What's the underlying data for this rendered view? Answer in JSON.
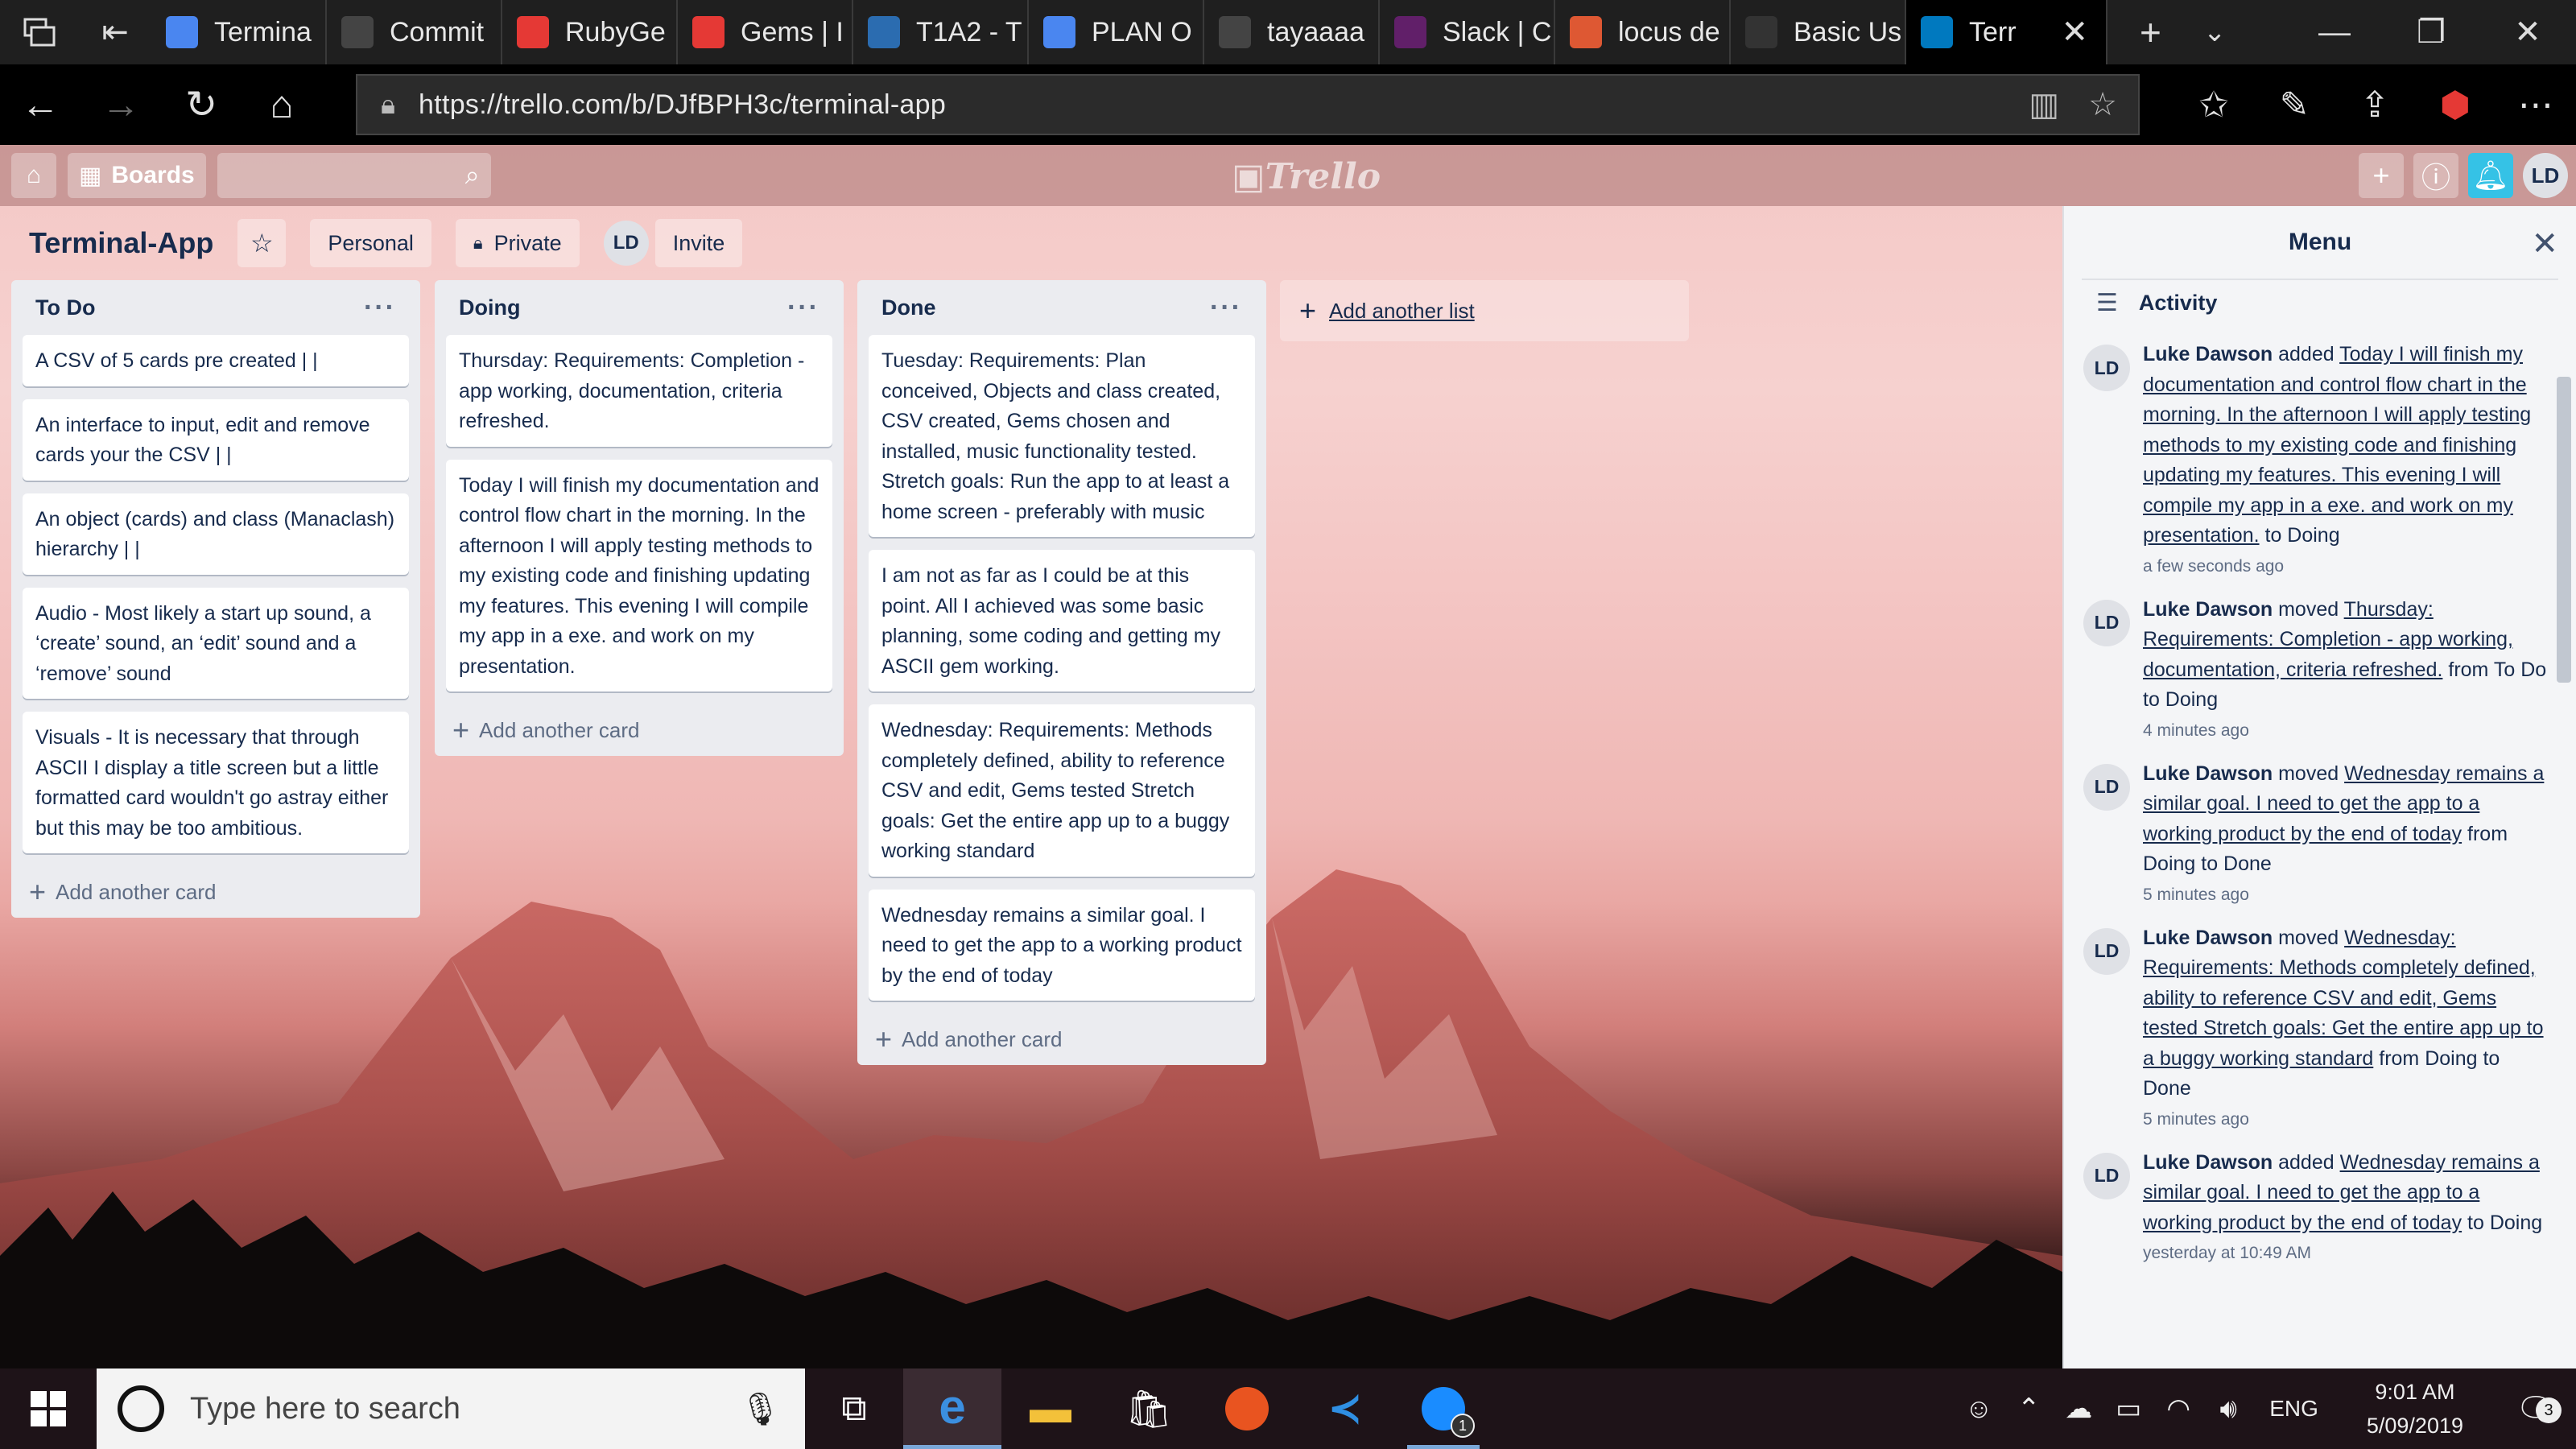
{
  "browser": {
    "tabs": [
      {
        "title": "Termina",
        "icon": "docs-icon",
        "color": "#4a86f0"
      },
      {
        "title": "Commit",
        "icon": "github-icon",
        "color": "#444444"
      },
      {
        "title": "RubyGe",
        "icon": "rubygems-icon",
        "color": "#e53935"
      },
      {
        "title": "Gems | I",
        "icon": "rubygems-icon",
        "color": "#e53935"
      },
      {
        "title": "T1A2 - T",
        "icon": "canvas-icon",
        "color": "#2b6cb0"
      },
      {
        "title": "PLAN O",
        "icon": "docs-icon",
        "color": "#4a86f0"
      },
      {
        "title": "tayaaaa",
        "icon": "github-icon",
        "color": "#444444"
      },
      {
        "title": "Slack | C",
        "icon": "slack-icon",
        "color": "#611f69"
      },
      {
        "title": "locus de",
        "icon": "duckduckgo-icon",
        "color": "#de5833"
      },
      {
        "title": "Basic Us",
        "icon": "user-icon",
        "color": "#333333"
      },
      {
        "title": "Terr",
        "icon": "trello-icon",
        "color": "#0079bf"
      }
    ],
    "url": "https://trello.com/b/DJfBPH3c/terminal-app"
  },
  "trello_header": {
    "boards_label": "Boards",
    "logo": "Trello",
    "avatar": "LD"
  },
  "board": {
    "title": "Terminal-App",
    "visibility_team": "Personal",
    "visibility_privacy": "Private",
    "member_avatar": "LD",
    "invite_label": "Invite"
  },
  "lists": [
    {
      "title": "To Do",
      "cards": [
        "A CSV of 5 cards pre created | |",
        "An interface to input, edit and remove cards your the CSV | |",
        "An object (cards) and class (Manaclash) hierarchy | |",
        "Audio - Most likely a start up sound, a ‘create’ sound, an ‘edit’ sound and a ‘remove’ sound",
        "Visuals - It is necessary that through ASCII I display a title screen but a little formatted card wouldn't go astray either but this may be too ambitious."
      ],
      "add_label": "Add another card"
    },
    {
      "title": "Doing",
      "cards": [
        "Thursday: Requirements: Completion - app working, documentation, criteria refreshed.",
        "Today I will finish my documentation and control flow chart in the morning. In the afternoon I will apply testing methods to my existing code and finishing updating my features. This evening I will compile my app in a exe. and work on my presentation."
      ],
      "add_label": "Add another card"
    },
    {
      "title": "Done",
      "cards": [
        "Tuesday: Requirements: Plan conceived, Objects and class created, CSV created, Gems chosen and installed, music functionality tested. Stretch goals: Run the app to at least a home screen - preferably with music",
        "I am not as far as I could be at this point. All I achieved was some basic planning, some coding and getting my ASCII gem working.",
        "Wednesday: Requirements: Methods completely defined, ability to reference CSV and edit, Gems tested Stretch goals: Get the entire app up to a buggy working standard",
        "Wednesday remains a similar goal. I need to get the app to a working product by the end of today"
      ],
      "add_label": "Add another card"
    }
  ],
  "add_list_label": "Add another list",
  "menu": {
    "title": "Menu",
    "activity_label": "Activity",
    "items": [
      {
        "avatar": "LD",
        "who": "Luke Dawson",
        "verb": " added ",
        "card": "Today I will finish my documentation and control flow chart in the morning. In the afternoon I will apply testing methods to my existing code and finishing updating my features. This evening I will compile my app in a exe. and work on my presentation.",
        "rest": " to Doing",
        "when": "a few seconds ago"
      },
      {
        "avatar": "LD",
        "who": "Luke Dawson",
        "verb": " moved ",
        "card": "Thursday: Requirements: Completion - app working, documentation, criteria refreshed.",
        "rest": " from To Do to Doing",
        "when": "4 minutes ago"
      },
      {
        "avatar": "LD",
        "who": "Luke Dawson",
        "verb": " moved ",
        "card": "Wednesday remains a similar goal. I need to get the app to a working product by the end of today",
        "rest": " from Doing to Done",
        "when": "5 minutes ago"
      },
      {
        "avatar": "LD",
        "who": "Luke Dawson",
        "verb": " moved ",
        "card": "Wednesday: Requirements: Methods completely defined, ability to reference CSV and edit, Gems tested Stretch goals: Get the entire app up to a buggy working standard",
        "rest": " from Doing to Done",
        "when": "5 minutes ago"
      },
      {
        "avatar": "LD",
        "who": "Luke Dawson",
        "verb": " added ",
        "card": "Wednesday remains a similar goal. I need to get the app to a working product by the end of today",
        "rest": " to Doing",
        "when": "yesterday at 10:49 AM"
      }
    ]
  },
  "taskbar": {
    "search_placeholder": "Type here to search",
    "language": "ENG",
    "time": "9:01 AM",
    "date": "5/09/2019",
    "notification_count": "3",
    "messenger_badge": "1"
  }
}
